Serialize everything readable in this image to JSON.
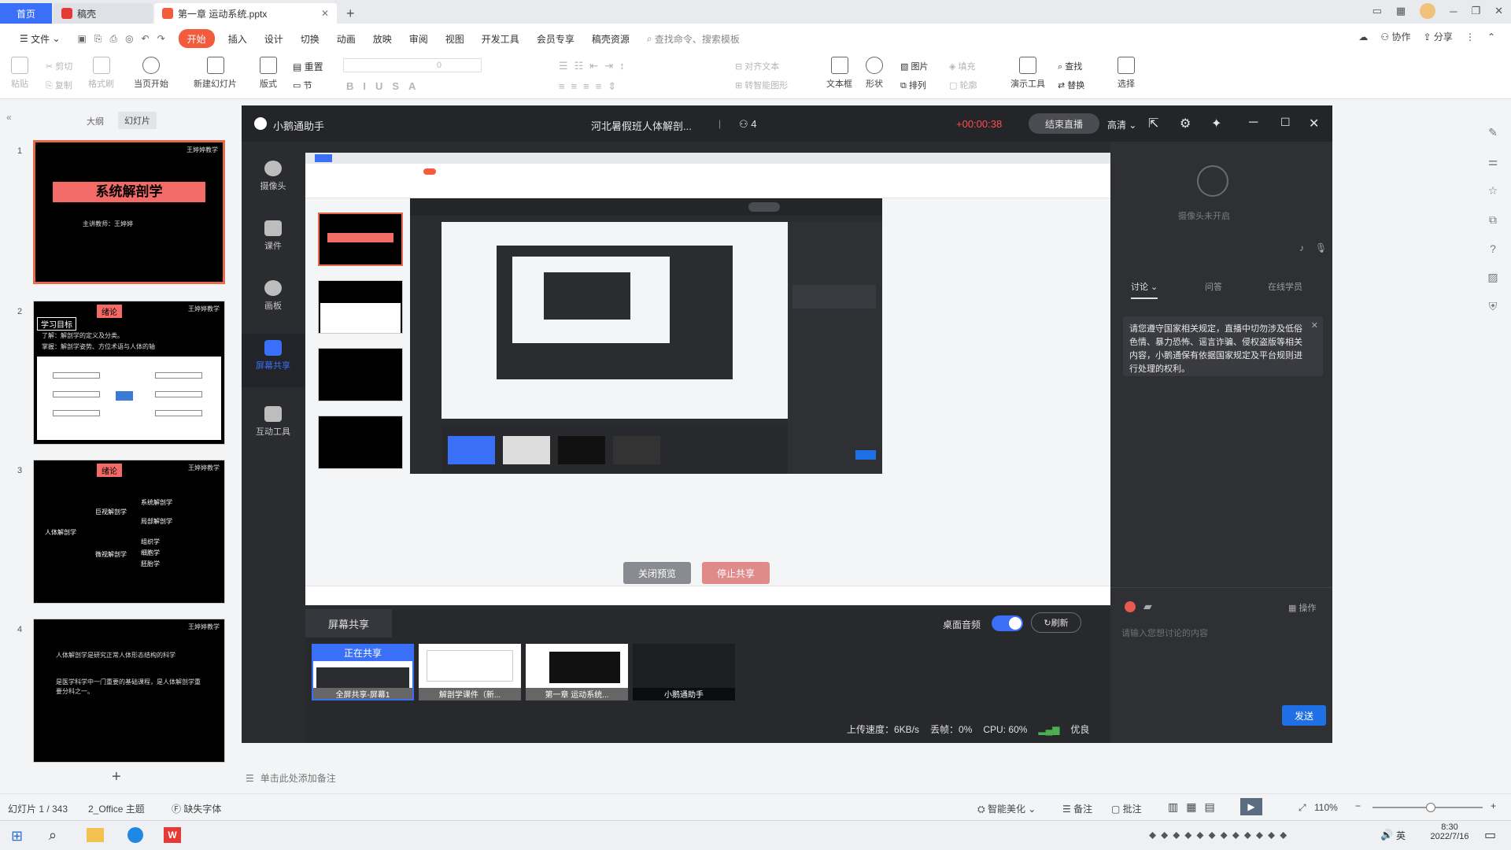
{
  "tabs": {
    "home": "首页",
    "tab2": "稿壳",
    "tab3": "第一章 运动系统.pptx",
    "add": "+"
  },
  "menu": {
    "file": "文件",
    "start": "开始",
    "items": [
      "插入",
      "设计",
      "切换",
      "动画",
      "放映",
      "审阅",
      "视图",
      "开发工具",
      "会员专享",
      "稿壳资源"
    ],
    "search": "查找命令、搜索模板",
    "collab": "协作",
    "share": "分享"
  },
  "ribbon": {
    "paste": "粘贴",
    "cut": "剪切",
    "copy": "复制",
    "format": "格式刷",
    "from_current": "当页开始",
    "new_slide": "新建幻灯片",
    "layout": "版式",
    "reset": "重置",
    "section": "节",
    "font_size": "0",
    "textbox": "文本框",
    "shape": "形状",
    "picture": "图片",
    "arrange": "排列",
    "fill": "填充",
    "outline": "轮廓",
    "present_tools": "演示工具",
    "find": "查找",
    "replace": "替换",
    "select": "选择",
    "align_text": "对齐文本",
    "convert_smart": "转智能图形"
  },
  "leftpane": {
    "outline_tab": "大纲",
    "slides_tab": "幻灯片",
    "slides": [
      {
        "num": "1",
        "title": "系统解剖学",
        "sub": "主讲教师：王婷婷"
      },
      {
        "num": "2",
        "badge": "绪论",
        "heading": "学习目标",
        "line1": "了解：解剖学的定义及分类。",
        "line2": "掌握：解剖学姿势、方位术语与人体的轴"
      },
      {
        "num": "3",
        "badge": "绪论",
        "root": "人体解剖学",
        "b1": "巨视解剖学",
        "b2": "微视解剖学",
        "l1": "系统解剖学",
        "l2": "局部解剖学",
        "l3": "组织学",
        "l4": "细胞学",
        "l5": "胚胎学"
      },
      {
        "num": "4",
        "text1": "人体解剖学是研究正常人体形态结构的科学",
        "text2": "是医学科学中一门重要的基础课程，是人体解剖学重要分科之一。"
      }
    ],
    "logo_text": "王婷婷教学",
    "add": "+"
  },
  "live": {
    "app_name": "小鹅通助手",
    "course_title": "河北暑假班人体解剖...",
    "viewers": "4",
    "timer": "+00:00:38",
    "end_button": "结束直播",
    "quality": "高清",
    "sidebar": [
      "摄像头",
      "课件",
      "画板",
      "屏幕共享",
      "互动工具"
    ],
    "camera_off": "摄像头未开启",
    "panel_tabs": [
      "讨论",
      "问答",
      "在线学员"
    ],
    "notice": "请您遵守国家相关规定，直播中切勿涉及低俗色情、暴力恐怖、谣言诈骗、侵权盗版等相关内容，小鹅通保有依据国家规定及平台规则进行处理的权利。",
    "input_placeholder": "请输入您想讨论的内容",
    "manage": "操作",
    "send": "发送",
    "close_preview": "关闭预览",
    "stop_share": "停止共享",
    "share_title": "屏幕共享",
    "desktop_audio": "桌面音频",
    "refresh": "刷新",
    "sharing_label": "正在共享",
    "sources": [
      "全屏共享-屏幕1",
      "解剖学课件（新...",
      "第一章 运动系统...",
      "小鹅通助手"
    ],
    "stats": {
      "upload": "上传速度：6KB/s",
      "loss": "丢帧：0%",
      "cpu": "CPU: 60%",
      "net": "优良"
    }
  },
  "notes": "单击此处添加备注",
  "statusbar": {
    "slide_count": "幻灯片 1 / 343",
    "theme": "2_Office 主题",
    "font_missing": "缺失字体",
    "beautify": "智能美化",
    "notes_btn": "备注",
    "comment_btn": "批注",
    "zoom": "110%"
  },
  "taskbar": {
    "time": "8:30",
    "date": "2022/7/16",
    "ime": "英"
  },
  "colors": {
    "accent": "#3a6ff7",
    "start": "#f25b3b",
    "live_bg": "#2b2c30",
    "send": "#1f6fe5",
    "red_timer": "#ff4d4f"
  }
}
